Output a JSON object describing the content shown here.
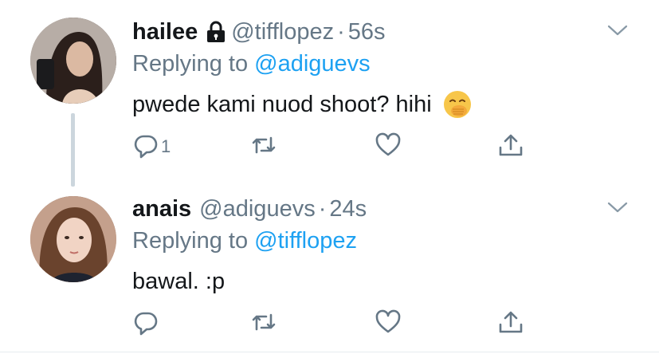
{
  "tweets": [
    {
      "name": "hailee",
      "handle": "@tifflopez",
      "separator": "·",
      "time": "56s",
      "replying_prefix": "Replying to",
      "replying_to": "@adiguevs",
      "text": "pwede kami nuod shoot? hihi",
      "emoji": "hand-over-mouth-emoji",
      "reply_count": "1",
      "protected": true
    },
    {
      "name": "anais",
      "handle": "@adiguevs",
      "separator": "·",
      "time": "24s",
      "replying_prefix": "Replying to",
      "replying_to": "@tifflopez",
      "text": "bawal. :p",
      "reply_count": "",
      "protected": false
    }
  ],
  "colors": {
    "link": "#1da1f2",
    "secondary_text": "#657786",
    "primary_text": "#14171a",
    "thread_line": "#ccd6dd"
  },
  "icons": [
    "lock-icon",
    "chevron-down-icon",
    "reply-icon",
    "retweet-icon",
    "like-icon",
    "share-icon"
  ]
}
